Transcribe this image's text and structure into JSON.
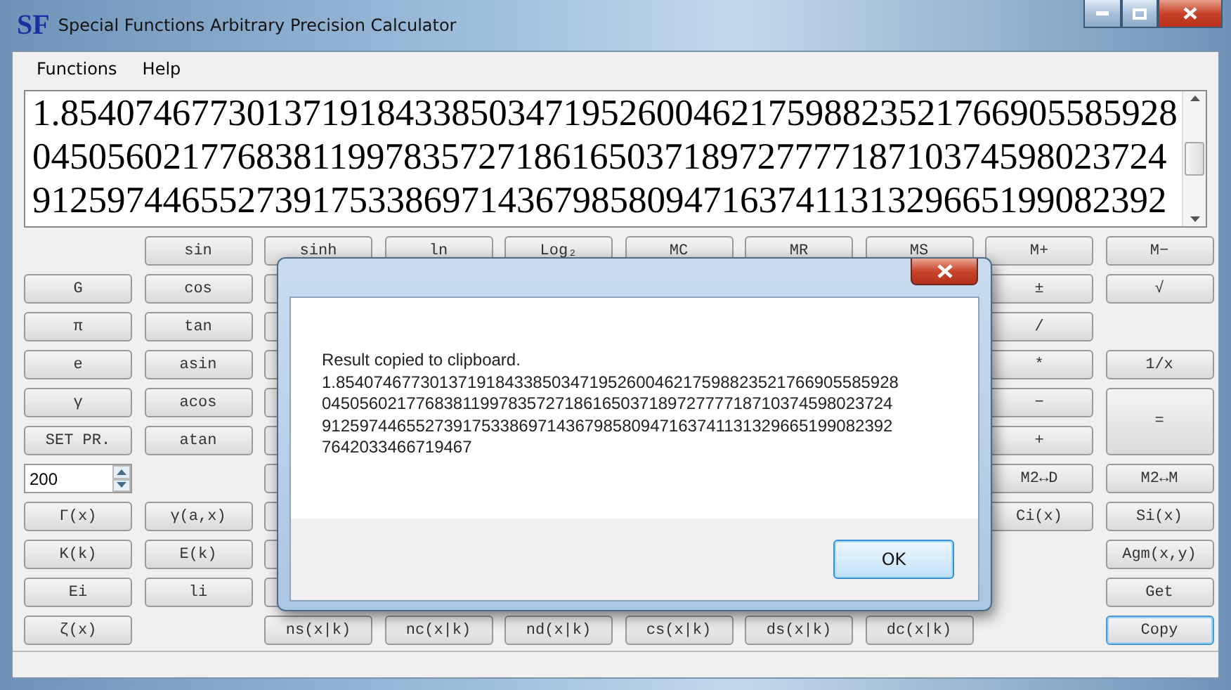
{
  "window": {
    "logo": "SF",
    "title": "Special Functions Arbitrary Precision Calculator"
  },
  "menu": [
    "Functions",
    "Help"
  ],
  "display": {
    "lines": [
      "1.854074677301371918433850347195260046217598823521766905585928",
      "0450560217768381199783572718616503718972777718710374598023724",
      "9125974465527391753386971436798580947163741131329665199082392"
    ]
  },
  "grid": [
    [
      {
        "kind": "gap"
      },
      {
        "kind": "button",
        "label": "sin",
        "focused": false
      },
      {
        "kind": "button",
        "label": "sinh",
        "focused": false
      },
      {
        "kind": "button",
        "label": "ln",
        "focused": false
      },
      {
        "kind": "button",
        "label": "Log₂",
        "focused": false
      },
      {
        "kind": "button",
        "label": "MC",
        "focused": false
      },
      {
        "kind": "button",
        "label": "MR",
        "focused": false
      },
      {
        "kind": "button",
        "label": "MS",
        "focused": false
      },
      {
        "kind": "button",
        "label": "M+",
        "focused": false
      },
      {
        "kind": "button",
        "label": "M−",
        "focused": false
      }
    ],
    [
      {
        "kind": "button",
        "label": "G",
        "focused": false
      },
      {
        "kind": "button",
        "label": "cos",
        "focused": false
      },
      {
        "kind": "covered"
      },
      {
        "kind": "gap"
      },
      {
        "kind": "gap"
      },
      {
        "kind": "gap"
      },
      {
        "kind": "gap"
      },
      {
        "kind": "gap"
      },
      {
        "kind": "button",
        "label": "±",
        "focused": false
      },
      {
        "kind": "button",
        "label": "√",
        "focused": false
      }
    ],
    [
      {
        "kind": "button",
        "label": "π",
        "focused": false
      },
      {
        "kind": "button",
        "label": "tan",
        "focused": false
      },
      {
        "kind": "covered"
      },
      {
        "kind": "gap"
      },
      {
        "kind": "gap"
      },
      {
        "kind": "gap"
      },
      {
        "kind": "gap"
      },
      {
        "kind": "gap"
      },
      {
        "kind": "button",
        "label": "/",
        "focused": false
      },
      {
        "kind": "gap"
      }
    ],
    [
      {
        "kind": "button",
        "label": "e",
        "focused": false
      },
      {
        "kind": "button",
        "label": "asin",
        "focused": false
      },
      {
        "kind": "covered"
      },
      {
        "kind": "gap"
      },
      {
        "kind": "gap"
      },
      {
        "kind": "gap"
      },
      {
        "kind": "gap"
      },
      {
        "kind": "gap"
      },
      {
        "kind": "button",
        "label": "*",
        "focused": false
      },
      {
        "kind": "button",
        "label": "1/x",
        "focused": false
      }
    ],
    [
      {
        "kind": "button",
        "label": "γ",
        "focused": false
      },
      {
        "kind": "button",
        "label": "acos",
        "focused": false
      },
      {
        "kind": "covered"
      },
      {
        "kind": "gap"
      },
      {
        "kind": "gap"
      },
      {
        "kind": "gap"
      },
      {
        "kind": "gap"
      },
      {
        "kind": "gap"
      },
      {
        "kind": "button",
        "label": "−",
        "focused": false
      },
      {
        "kind": "tall",
        "label": "=",
        "focused": false
      }
    ],
    [
      {
        "kind": "button",
        "label": "SET PR.",
        "focused": false
      },
      {
        "kind": "button",
        "label": "atan",
        "focused": false
      },
      {
        "kind": "covered"
      },
      {
        "kind": "gap"
      },
      {
        "kind": "gap"
      },
      {
        "kind": "gap"
      },
      {
        "kind": "gap"
      },
      {
        "kind": "gap"
      },
      {
        "kind": "button",
        "label": "+",
        "focused": false
      }
    ],
    [
      {
        "kind": "spin",
        "value": "200"
      },
      {
        "kind": "gap"
      },
      {
        "kind": "covered"
      },
      {
        "kind": "gap"
      },
      {
        "kind": "gap"
      },
      {
        "kind": "gap"
      },
      {
        "kind": "gap"
      },
      {
        "kind": "gap"
      },
      {
        "kind": "button",
        "label": "M2↔D",
        "focused": false
      },
      {
        "kind": "button",
        "label": "M2↔M",
        "focused": false
      }
    ],
    [
      {
        "kind": "button",
        "label": "Γ(x)",
        "focused": false
      },
      {
        "kind": "button",
        "label": "γ(a,x)",
        "focused": false
      },
      {
        "kind": "covered"
      },
      {
        "kind": "gap"
      },
      {
        "kind": "gap"
      },
      {
        "kind": "gap"
      },
      {
        "kind": "gap"
      },
      {
        "kind": "gap"
      },
      {
        "kind": "button",
        "label": "Ci(x)",
        "focused": false
      },
      {
        "kind": "button",
        "label": "Si(x)",
        "focused": false
      }
    ],
    [
      {
        "kind": "button",
        "label": "K(k)",
        "focused": false
      },
      {
        "kind": "button",
        "label": "E(k)",
        "focused": false
      },
      {
        "kind": "covered"
      },
      {
        "kind": "gap"
      },
      {
        "kind": "gap"
      },
      {
        "kind": "gap"
      },
      {
        "kind": "gap"
      },
      {
        "kind": "gap"
      },
      {
        "kind": "gap"
      },
      {
        "kind": "button",
        "label": "Agm(x,y)",
        "focused": false
      }
    ],
    [
      {
        "kind": "button",
        "label": "Ei",
        "focused": false
      },
      {
        "kind": "button",
        "label": "li",
        "focused": false
      },
      {
        "kind": "covered"
      },
      {
        "kind": "gap"
      },
      {
        "kind": "gap"
      },
      {
        "kind": "gap"
      },
      {
        "kind": "gap"
      },
      {
        "kind": "gap"
      },
      {
        "kind": "gap"
      },
      {
        "kind": "button",
        "label": "Get",
        "focused": false
      }
    ],
    [
      {
        "kind": "button",
        "label": "ζ(x)",
        "focused": false
      },
      {
        "kind": "gap"
      },
      {
        "kind": "button",
        "label": "ns(x|k)",
        "focused": false
      },
      {
        "kind": "button",
        "label": "nc(x|k)",
        "focused": false
      },
      {
        "kind": "button",
        "label": "nd(x|k)",
        "focused": false
      },
      {
        "kind": "button",
        "label": "cs(x|k)",
        "focused": false
      },
      {
        "kind": "button",
        "label": "ds(x|k)",
        "focused": false
      },
      {
        "kind": "button",
        "label": "dc(x|k)",
        "focused": false
      },
      {
        "kind": "gap"
      },
      {
        "kind": "button",
        "label": "Copy",
        "focused": true
      }
    ]
  ],
  "dialog": {
    "message": [
      "Result copied to clipboard.",
      "1.854074677301371918433850347195260046217598823521766905585928",
      "0450560217768381199783572718616503718972777718710374598023724",
      "9125974465527391753386971436798580947163741131329665199082392",
      "7642033466719467"
    ],
    "button": "OK"
  }
}
